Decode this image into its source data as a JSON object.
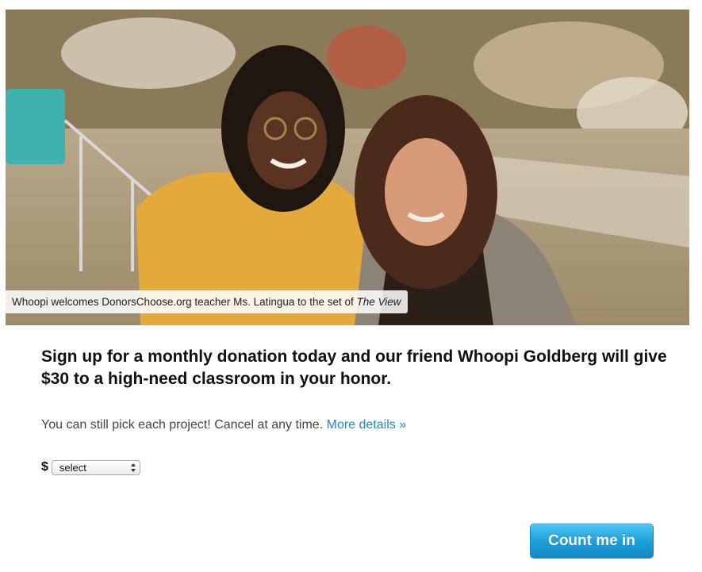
{
  "hero": {
    "caption_prefix": "Whoopi welcomes DonorsChoose.org teacher Ms. Latingua to the set of ",
    "caption_show": "The View"
  },
  "offer": {
    "headline": "Sign up for a monthly donation today and our friend Whoopi Goldberg will give $30 to a high-need classroom in your honor.",
    "subline": "You can still pick each project! Cancel at any time.",
    "details_link": "More details »"
  },
  "amount": {
    "currency_symbol": "$",
    "selected_value": "select"
  },
  "cta": {
    "label": "Count me in"
  },
  "colors": {
    "link": "#1a8ac6",
    "button": "#1a9dd8"
  }
}
